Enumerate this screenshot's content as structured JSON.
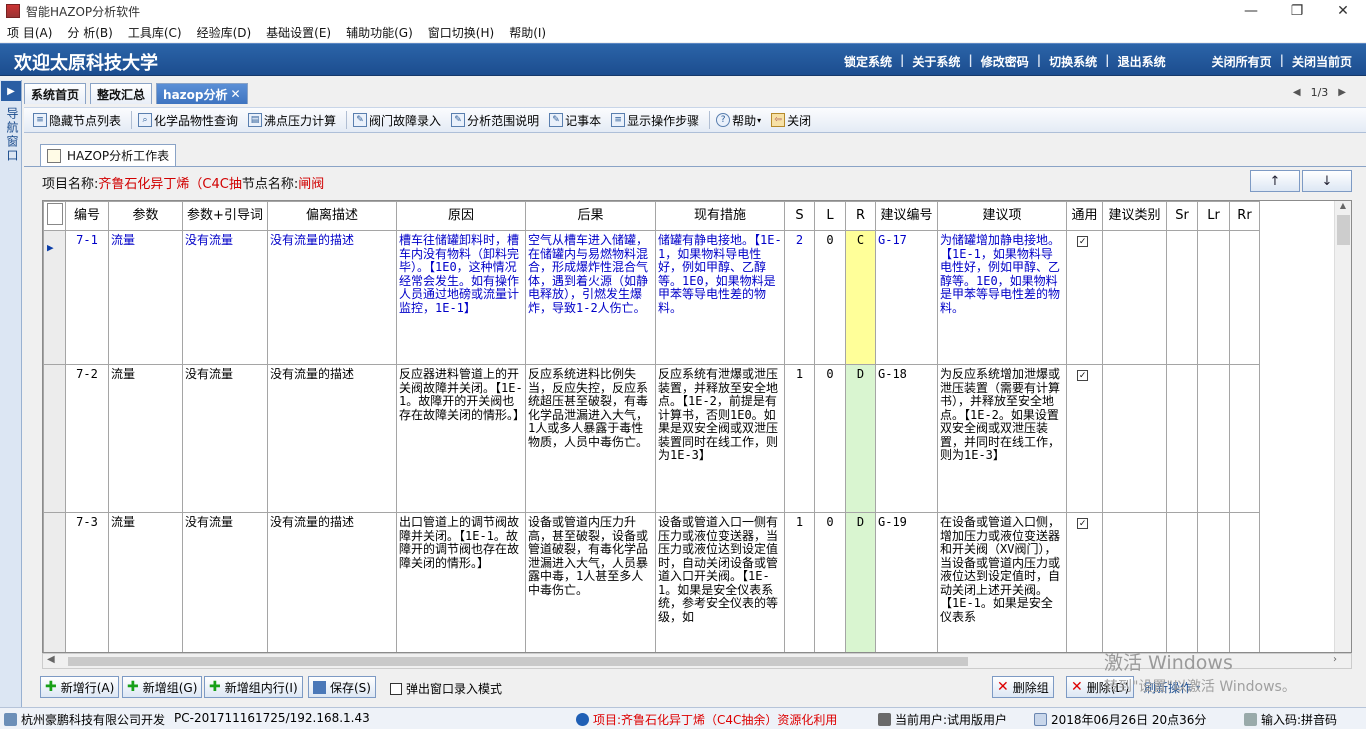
{
  "app_title": "智能HAZOP分析软件",
  "window_controls": {
    "minimize": "—",
    "maximize": "❐",
    "close": "✕"
  },
  "menu": [
    "项 目(A)",
    "分 析(B)",
    "工具库(C)",
    "经验库(D)",
    "基础设置(E)",
    "辅助功能(G)",
    "窗口切换(H)",
    "帮助(I)"
  ],
  "banner": {
    "welcome": "欢迎太原科技大学",
    "links": [
      "锁定系统",
      "关于系统",
      "修改密码",
      "切换系统",
      "退出系统"
    ],
    "right_links": [
      "关闭所有页",
      "关闭当前页"
    ]
  },
  "sidebar": {
    "label": "导航窗口"
  },
  "tabs": [
    "系统首页",
    "整改汇总",
    "hazop分析"
  ],
  "pager": {
    "text": "1/3",
    "prev": "◀",
    "next": "▶"
  },
  "toolbar": [
    "隐藏节点列表",
    "化学品物性查询",
    "沸点压力计算",
    "阀门故障录入",
    "分析范围说明",
    "记事本",
    "显示操作步骤",
    "帮助",
    "关闭"
  ],
  "subtab": "HAZOP分析工作表",
  "project": {
    "name_label": "项目名称:",
    "name_value": "齐鲁石化异丁烯（C4C抽",
    "node_label": "节点名称:",
    "node_value": "闸阀"
  },
  "arrows": {
    "up": "↑",
    "down": "↓"
  },
  "table": {
    "headers": [
      "编号",
      "参数",
      "参数+引导词",
      "偏离描述",
      "原因",
      "后果",
      "现有措施",
      "S",
      "L",
      "R",
      "建议编号",
      "建议项",
      "通用",
      "建议类别",
      "Sr",
      "Lr",
      "Rr"
    ],
    "rows": [
      {
        "id": "7-1",
        "param": "流量",
        "guide": "没有流量",
        "deviation": "没有流量的描述",
        "cause": "槽车往储罐卸料时，槽车内没有物料（卸料完毕）。【1E0，这种情况经常会发生。如有操作人员通过地磅或流量计监控，1E-1】",
        "consequence": "空气从槽车进入储罐，在储罐内与易燃物料混合，形成爆炸性混合气体，遇到着火源（如静电释放），引燃发生爆炸，导致1-2人伤亡。",
        "measures": "储罐有静电接地。【1E-1，如果物料导电性好，例如甲醇、乙醇等。1E0，如果物料是甲苯等导电性差的物料。",
        "S": "2",
        "L": "0",
        "R": "C",
        "sug_id": "G-17",
        "suggestion": "为储罐增加静电接地。【1E-1，如果物料导电性好，例如甲醇、乙醇等。1E0，如果物料是甲苯等导电性差的物料。",
        "general": "✓",
        "blue": true
      },
      {
        "id": "7-2",
        "param": "流量",
        "guide": "没有流量",
        "deviation": "没有流量的描述",
        "cause": "反应器进料管道上的开关阀故障并关闭。【1E-1。故障开的开关阀也存在故障关闭的情形。】",
        "consequence": "反应系统进料比例失当，反应失控，反应系统超压甚至破裂，有毒化学品泄漏进入大气，1人或多人暴露于毒性物质，人员中毒伤亡。",
        "measures": "反应系统有泄爆或泄压装置，并释放至安全地点。【1E-2，前提是有计算书，否则1E0。如果是双安全阀或双泄压装置同时在线工作，则为1E-3】",
        "S": "1",
        "L": "0",
        "R": "D",
        "sug_id": "G-18",
        "suggestion": "为反应系统增加泄爆或泄压装置（需要有计算书），并释放至安全地点。【1E-2。如果设置双安全阀或双泄压装置，并同时在线工作，则为1E-3】",
        "general": "✓",
        "blue": false
      },
      {
        "id": "7-3",
        "param": "流量",
        "guide": "没有流量",
        "deviation": "没有流量的描述",
        "cause": "出口管道上的调节阀故障并关闭。【1E-1。故障开的调节阀也存在故障关闭的情形。】",
        "consequence": "设备或管道内压力升高，甚至破裂，设备或管道破裂，有毒化学品泄漏进入大气，人员暴露中毒，1人甚至多人中毒伤亡。",
        "measures": "设备或管道入口一侧有压力或液位变送器，当压力或液位达到设定值时，自动关闭设备或管道入口开关阀。【1E-1。如果是安全仪表系统，参考安全仪表的等级，如",
        "S": "1",
        "L": "0",
        "R": "D",
        "sug_id": "G-19",
        "suggestion": "在设备或管道入口侧，增加压力或液位变送器和开关阀（XV阀门），当设备或管道内压力或液位达到设定值时，自动关闭上述开关阀。【1E-1。如果是安全仪表系",
        "general": "✓",
        "blue": false
      }
    ]
  },
  "buttons": {
    "add_row": "新增行(A)",
    "add_group": "新增组(G)",
    "add_group_row": "新增组内行(I)",
    "save": "保存(S)",
    "popup": "弹出窗口录入模式",
    "delete_group": "删除组",
    "delete": "删除(D)",
    "refresh": "刷新操作"
  },
  "watermark": {
    "line1": "激活 Windows",
    "line2": "转到\"设置\"以激活 Windows。"
  },
  "statusbar": {
    "company": "杭州豪鹏科技有限公司开发",
    "pc": "PC-201711161725/192.168.1.43",
    "project": "项目:齐鲁石化异丁烯（C4C抽余）资源化利用",
    "user": "当前用户:试用版用户",
    "datetime": "2018年06月26日 20点36分",
    "ime": "输入码:拼音码"
  },
  "colors": {
    "banner": "#1c4d8f",
    "risk_C": "#ffff99",
    "risk_D": "#d9f5d0",
    "project_red": "#d10000",
    "blue_text": "#0000c8"
  }
}
